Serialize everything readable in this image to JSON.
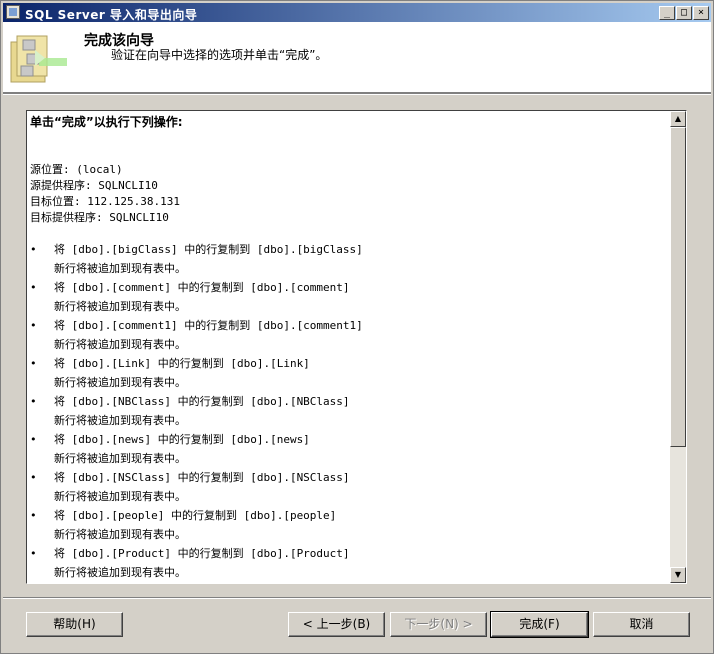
{
  "window": {
    "title": "SQL Server 导入和导出向导",
    "controls": {
      "minimize": "_",
      "maximize": "□",
      "close": "×"
    }
  },
  "header": {
    "title": "完成该向导",
    "subtitle": "验证在向导中选择的选项并单击“完成”。",
    "icon": "wizard-icon"
  },
  "summary": {
    "intro": "单击“完成”以执行下列操作:",
    "source_lines": [
      "源位置: (local)",
      "源提供程序: SQLNCLI10",
      "目标位置: 112.125.38.131",
      "目标提供程序: SQLNCLI10"
    ],
    "bullet": "•",
    "operations": [
      {
        "line1": "将 [dbo].[bigClass] 中的行复制到 [dbo].[bigClass]",
        "line2": "新行将被追加到现有表中。"
      },
      {
        "line1": "将 [dbo].[comment] 中的行复制到 [dbo].[comment]",
        "line2": "新行将被追加到现有表中。"
      },
      {
        "line1": "将 [dbo].[comment1] 中的行复制到 [dbo].[comment1]",
        "line2": "新行将被追加到现有表中。"
      },
      {
        "line1": "将 [dbo].[Link] 中的行复制到 [dbo].[Link]",
        "line2": "新行将被追加到现有表中。"
      },
      {
        "line1": "将 [dbo].[NBClass] 中的行复制到 [dbo].[NBClass]",
        "line2": "新行将被追加到现有表中。"
      },
      {
        "line1": "将 [dbo].[news] 中的行复制到 [dbo].[news]",
        "line2": "新行将被追加到现有表中。"
      },
      {
        "line1": "将 [dbo].[NSClass] 中的行复制到 [dbo].[NSClass]",
        "line2": "新行将被追加到现有表中。"
      },
      {
        "line1": "将 [dbo].[people] 中的行复制到 [dbo].[people]",
        "line2": "新行将被追加到现有表中。"
      },
      {
        "line1": "将 [dbo].[Product] 中的行复制到 [dbo].[Product]",
        "line2": "新行将被追加到现有表中。"
      }
    ],
    "scrollbar": {
      "up": "▲",
      "down": "▼"
    }
  },
  "buttons": {
    "help": "帮助(H)",
    "back": "< 上一步(B)",
    "next": "下一步(N) >",
    "finish": "完成(F)",
    "cancel": "取消"
  }
}
